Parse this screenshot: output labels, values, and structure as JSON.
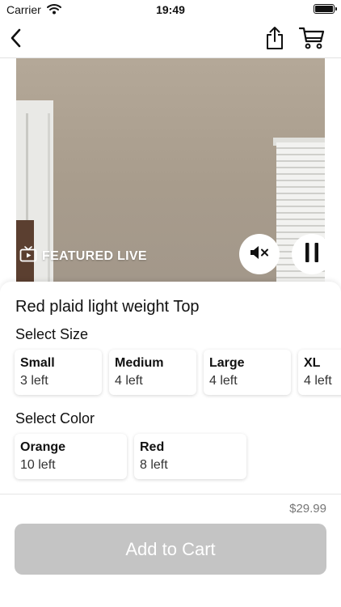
{
  "status_bar": {
    "carrier": "Carrier",
    "time": "19:49",
    "icons": [
      "wifi-icon",
      "battery-icon"
    ]
  },
  "nav": {
    "icons": [
      "back-chevron-icon",
      "share-icon",
      "cart-icon"
    ]
  },
  "video": {
    "badge_label": "FEATURED LIVE",
    "badge_icon": "live-tv-icon",
    "muted": true,
    "controls": [
      "mute-icon",
      "pause-icon"
    ]
  },
  "product": {
    "title": "Red plaid light weight Top",
    "size_label": "Select Size",
    "sizes": [
      {
        "name": "Small",
        "stock": "3 left"
      },
      {
        "name": "Medium",
        "stock": "4 left"
      },
      {
        "name": "Large",
        "stock": "4 left"
      },
      {
        "name": "XL",
        "stock": "4 left"
      }
    ],
    "color_label": "Select Color",
    "colors": [
      {
        "name": "Orange",
        "stock": "10 left"
      },
      {
        "name": "Red",
        "stock": "8 left"
      }
    ]
  },
  "footer": {
    "price": "$29.99",
    "add_to_cart_label": "Add to Cart",
    "add_to_cart_enabled": false
  },
  "colors": {
    "button_disabled": "#c4c4c4",
    "text_primary": "#111111",
    "price_text": "#777777"
  }
}
